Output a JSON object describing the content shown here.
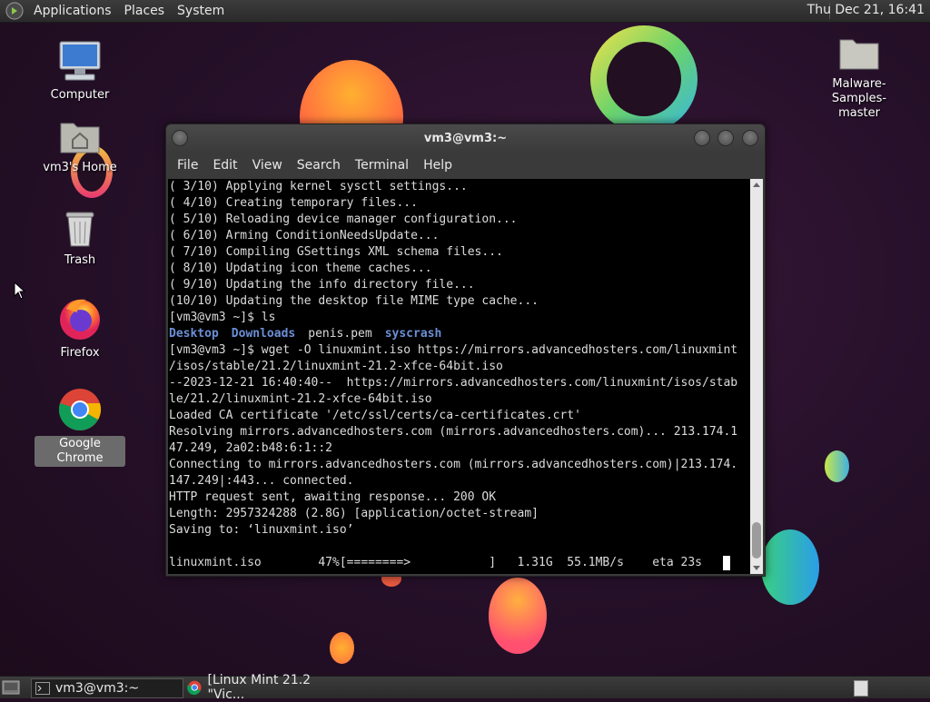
{
  "top_panel": {
    "menus": [
      "Applications",
      "Places",
      "System"
    ],
    "clock": "Thu Dec 21, 16:41"
  },
  "desktop_icons": {
    "computer": "Computer",
    "home": "vm3's Home",
    "trash": "Trash",
    "firefox": "Firefox",
    "chrome": "Google Chrome",
    "malware": "Malware-Samples-\nmaster"
  },
  "terminal": {
    "title": "vm3@vm3:~",
    "menus": [
      "File",
      "Edit",
      "View",
      "Search",
      "Terminal",
      "Help"
    ],
    "lines": [
      "( 3/10) Applying kernel sysctl settings...",
      "( 4/10) Creating temporary files...",
      "( 5/10) Reloading device manager configuration...",
      "( 6/10) Arming ConditionNeedsUpdate...",
      "( 7/10) Compiling GSettings XML schema files...",
      "( 8/10) Updating icon theme caches...",
      "( 9/10) Updating the info directory file...",
      "(10/10) Updating the desktop file MIME type cache...",
      "[vm3@vm3 ~]$ ls"
    ],
    "ls_output": [
      "Desktop",
      "Downloads",
      "penis.pem",
      "syscrash"
    ],
    "lines2": [
      "[vm3@vm3 ~]$ wget -O linuxmint.iso https://mirrors.advancedhosters.com/linuxmint",
      "/isos/stable/21.2/linuxmint-21.2-xfce-64bit.iso",
      "--2023-12-21 16:40:40--  https://mirrors.advancedhosters.com/linuxmint/isos/stab",
      "le/21.2/linuxmint-21.2-xfce-64bit.iso",
      "Loaded CA certificate '/etc/ssl/certs/ca-certificates.crt'",
      "Resolving mirrors.advancedhosters.com (mirrors.advancedhosters.com)... 213.174.1",
      "47.249, 2a02:b48:6:1::2",
      "Connecting to mirrors.advancedhosters.com (mirrors.advancedhosters.com)|213.174.",
      "147.249|:443... connected.",
      "HTTP request sent, awaiting response... 200 OK",
      "Length: 2957324288 (2.8G) [application/octet-stream]",
      "Saving to: ‘linuxmint.iso’",
      ""
    ],
    "progress_line": "linuxmint.iso        47%[========>           ]   1.31G  55.1MB/s    eta 23s   "
  },
  "taskbar": {
    "items": [
      "vm3@vm3:~",
      "[Linux Mint 21.2 \"Vic..."
    ]
  },
  "colors": {
    "ls_dir": "#6b8fd6",
    "terminal_bg": "#000000",
    "panel_bg": "#333333"
  }
}
